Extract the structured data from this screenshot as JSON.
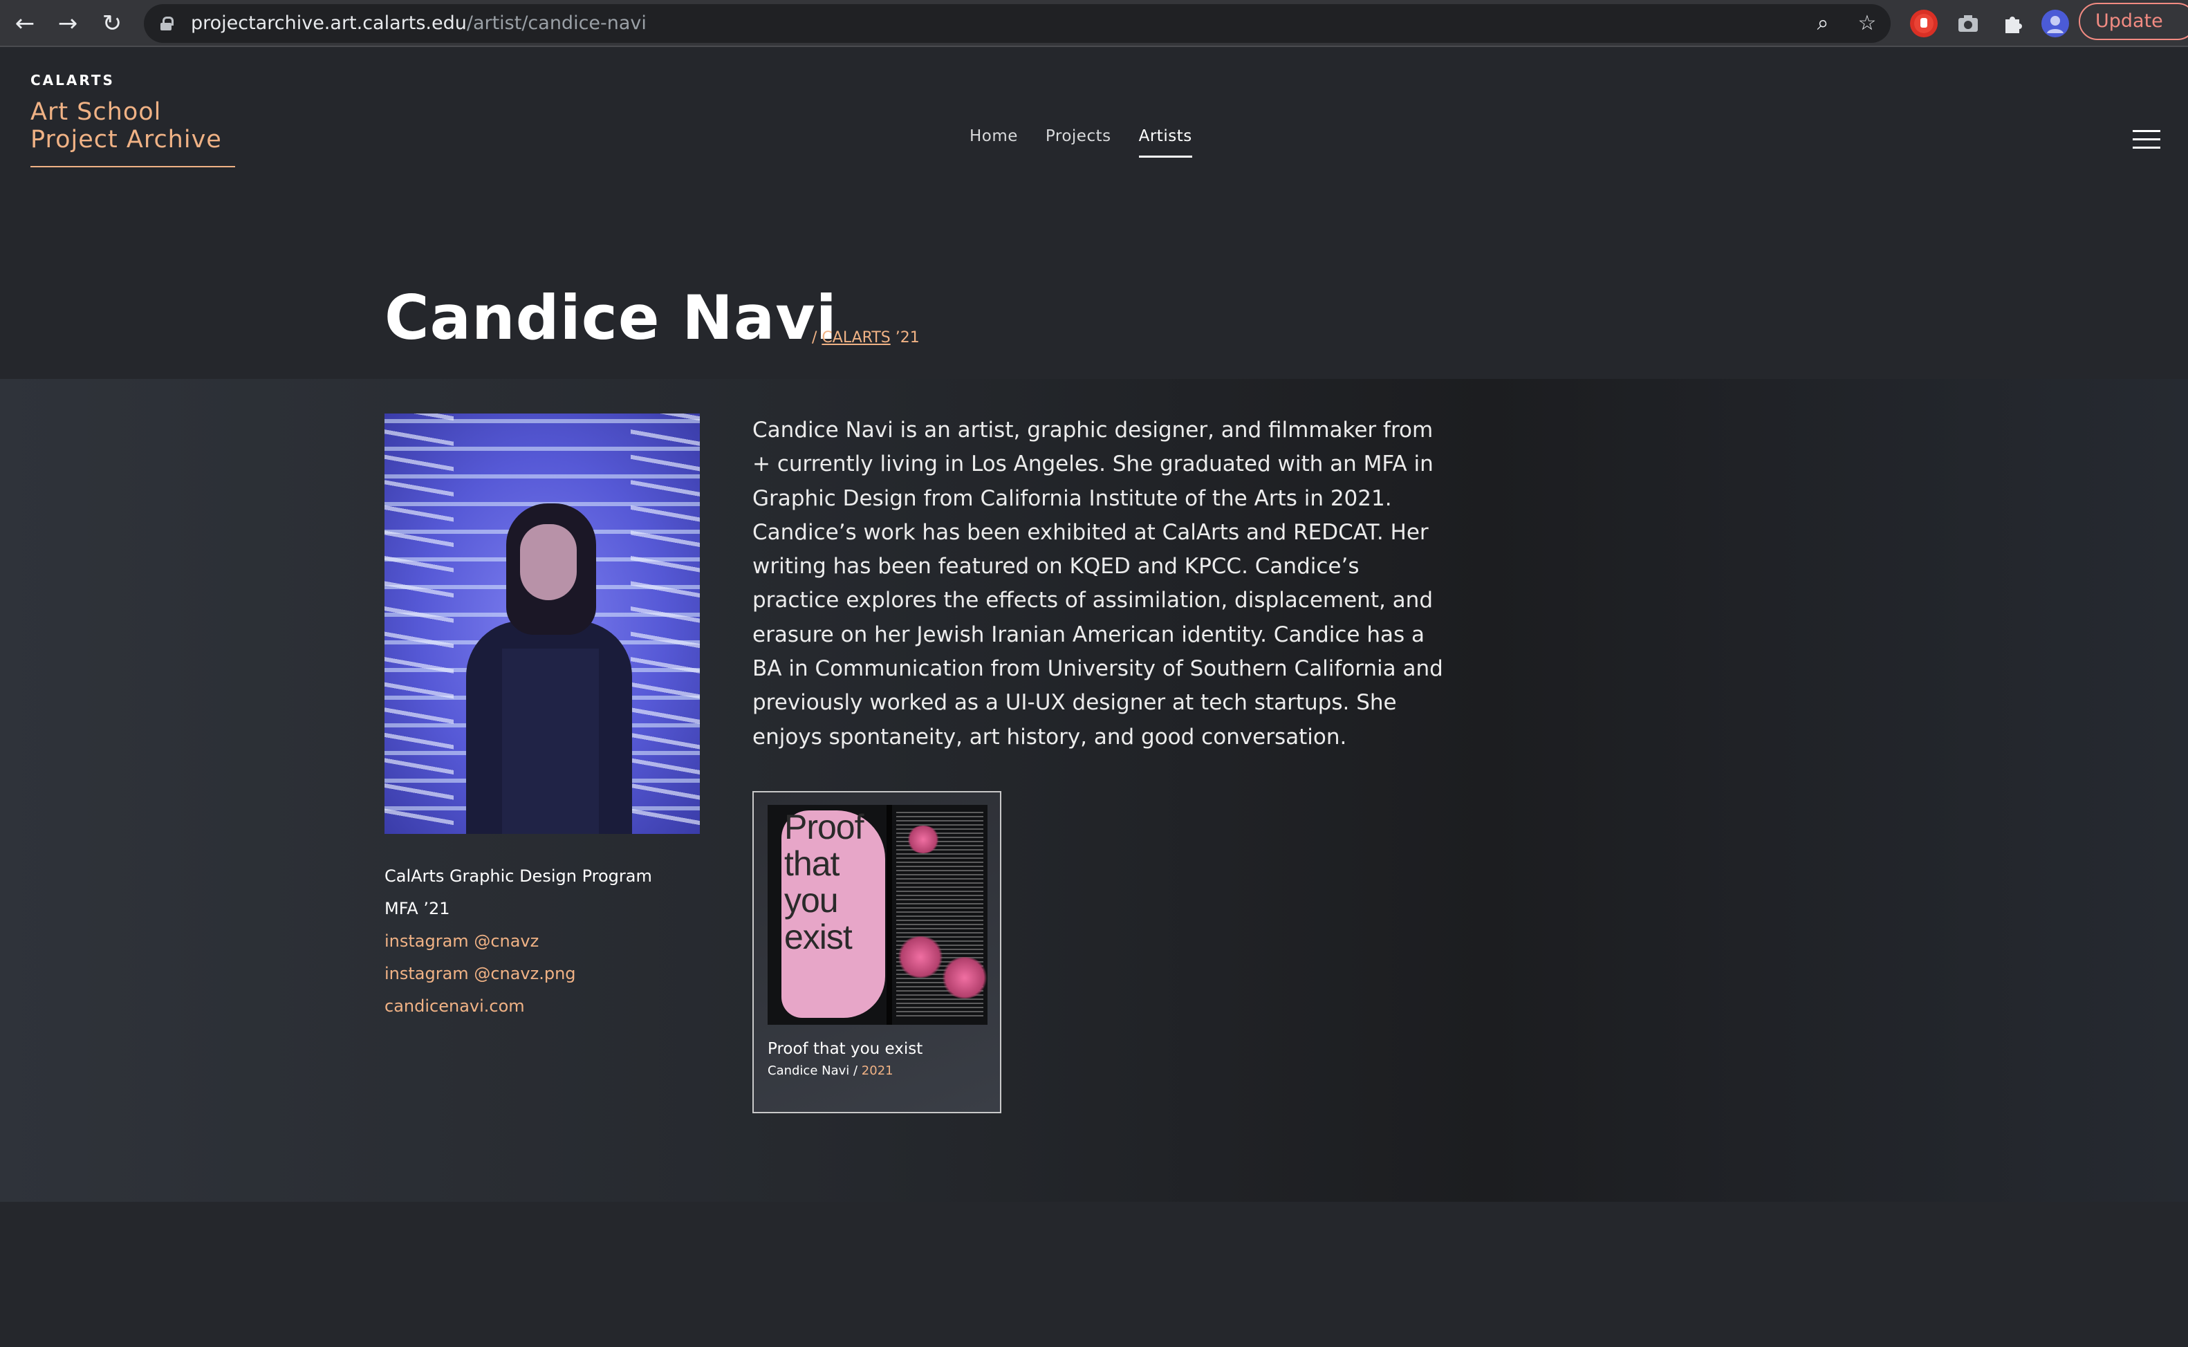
{
  "browser": {
    "url_host": "projectarchive.art.calarts.edu",
    "url_path": "/artist/candice-navi",
    "update_label": "Update",
    "back_icon": "←",
    "forward_icon": "→",
    "reload_icon": "↻",
    "zoom_icon": "⌕",
    "star_icon": "☆"
  },
  "site": {
    "kicker": "CALARTS",
    "brand_line1": "Art School",
    "brand_line2": "Project Archive",
    "nav": [
      {
        "label": "Home"
      },
      {
        "label": "Projects"
      },
      {
        "label": "Artists",
        "active": true
      }
    ]
  },
  "artist": {
    "name": "Candice Navi",
    "meta_prefix": "/ ",
    "meta_school": "CALARTS",
    "meta_year": " ’21",
    "bio": "Candice Navi is an artist, graphic designer, and filmmaker from + currently living in Los Angeles. She graduated with an MFA in Graphic Design from California Institute of the Arts in 2021. Candice’s work has been exhibited at CalArts and REDCAT. Her writing has been featured on KQED and KPCC. Candice’s practice explores the effects of assimilation, displacement, and erasure on her Jewish Iranian American identity. Candice has a BA in Communication from University of Southern California and previously worked as a UI-UX designer at tech startups. She enjoys spontaneity, art history, and good conversation.",
    "program": "CalArts Graphic Design Program",
    "degree": "MFA ’21",
    "links": [
      {
        "label": "instagram @cnavz"
      },
      {
        "label": "instagram @cnavz.png"
      },
      {
        "label": "candicenavi.com"
      }
    ]
  },
  "projects": [
    {
      "title": "Proof that you exist",
      "thumb_text": "Proof that you exist",
      "author": "Candice Navi",
      "separator": " / ",
      "year": "2021"
    }
  ],
  "colors": {
    "accent": "#f0b285",
    "background": "#25272c"
  }
}
